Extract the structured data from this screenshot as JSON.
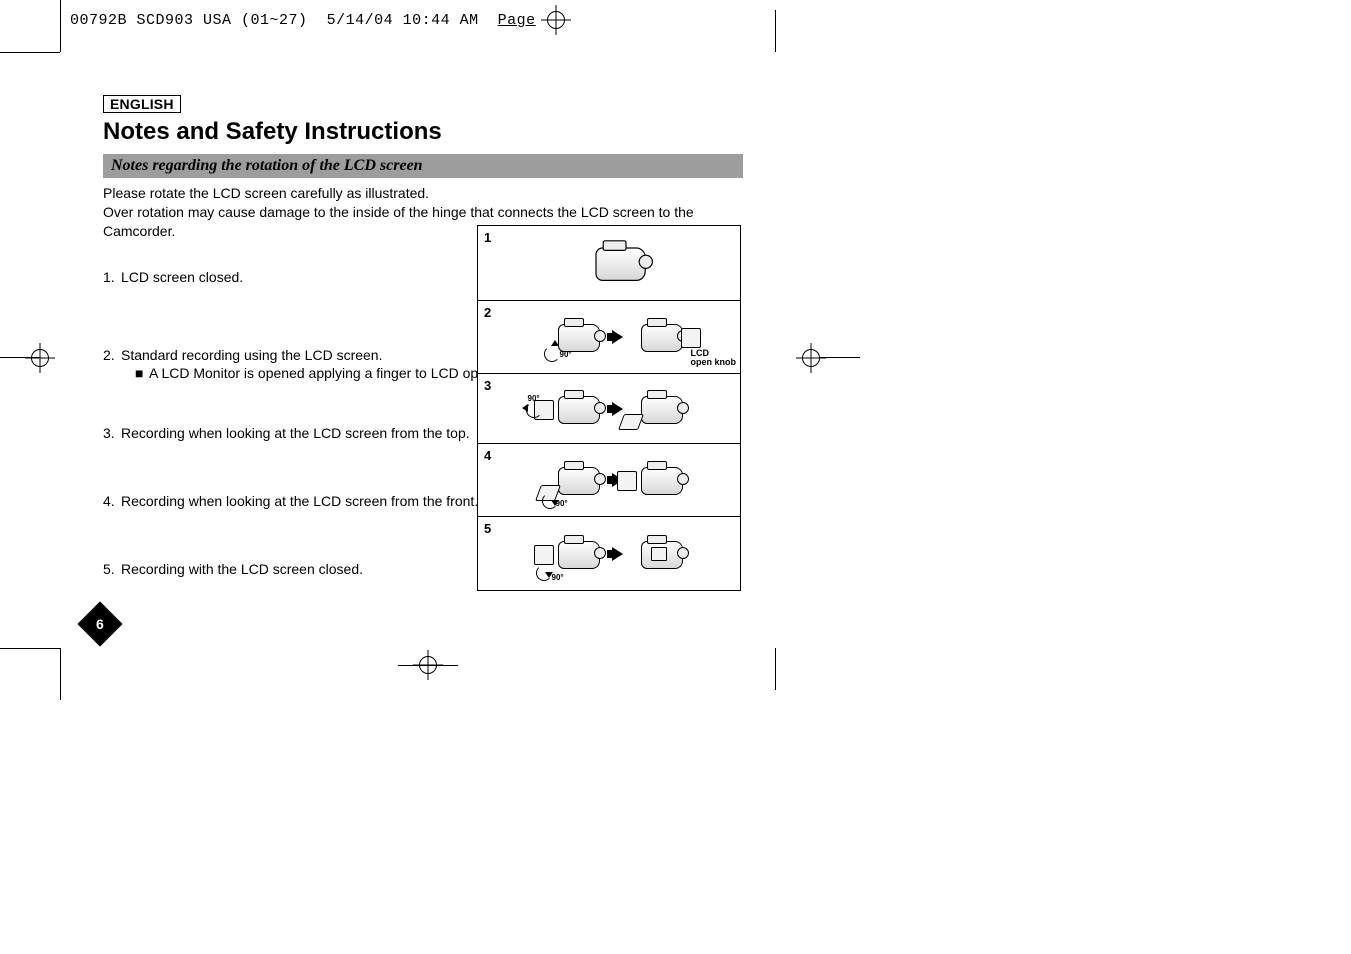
{
  "slug": {
    "file": "00792B SCD903 USA (01~27)",
    "date": "5/14/04",
    "time": "10:44 AM",
    "pageword": "Page",
    "pagenum": "6"
  },
  "language_label": "ENGLISH",
  "title": "Notes and Safety Instructions",
  "section_heading": "Notes regarding the rotation of the LCD screen",
  "lead_line1": "Please rotate the LCD screen carefully as illustrated.",
  "lead_line2": "Over rotation may cause damage to the inside of the hinge that connects the LCD screen to the Camcorder.",
  "items": [
    {
      "num": "1.",
      "text": "LCD screen closed."
    },
    {
      "num": "2.",
      "text": "Standard recording using the LCD screen.",
      "sub_mark": "■",
      "sub_text": "A LCD Monitor is opened applying a finger to LCD open knob."
    },
    {
      "num": "3.",
      "text": "Recording when looking at the LCD screen from the top."
    },
    {
      "num": "4.",
      "text": "Recording when looking at the LCD screen from the front."
    },
    {
      "num": "5.",
      "text": "Recording with the LCD screen closed."
    }
  ],
  "figure": {
    "row_nums": [
      "1",
      "2",
      "3",
      "4",
      "5"
    ],
    "angle90": "90°",
    "lcd_label_line1": "LCD",
    "lcd_label_line2": "open knob"
  },
  "page_number": "6"
}
